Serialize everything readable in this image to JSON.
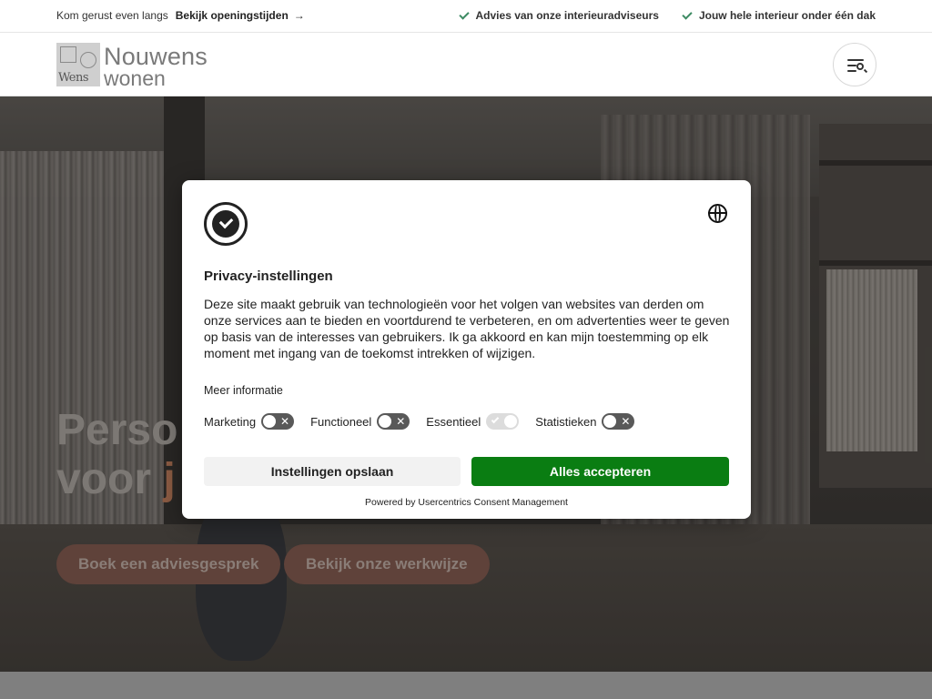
{
  "topbar": {
    "intro": "Kom gerust even langs",
    "opening_link": "Bekijk openingstijden",
    "arrow_icon": "→",
    "usps": [
      "Advies van onze interieuradviseurs",
      "Jouw hele interieur onder één dak"
    ]
  },
  "header": {
    "logo_line1": "Nouwens",
    "logo_line2": "wonen",
    "logo_mark_text": "Wens",
    "menu_icon": "menu-search-icon"
  },
  "hero": {
    "title_line1": "Perso",
    "title_line2": "voor",
    "title_accent": "j",
    "buttons": [
      "Boek een adviesgesprek",
      "Bekijk onze werkwijze"
    ]
  },
  "consent": {
    "title": "Privacy-instellingen",
    "body": "Deze site maakt gebruik van technologieën voor het volgen van websites van derden om onze services aan te bieden en voortdurend te verbeteren, en om advertenties weer te geven op basis van de interesses van gebruikers. Ik ga akkoord en kan mijn toestemming op elk moment met ingang van de toekomst intrekken of wijzigen.",
    "more_info": "Meer informatie",
    "toggles": [
      {
        "label": "Marketing",
        "state": "off"
      },
      {
        "label": "Functioneel",
        "state": "off"
      },
      {
        "label": "Essentieel",
        "state": "on-disabled"
      },
      {
        "label": "Statistieken",
        "state": "off"
      }
    ],
    "save_label": "Instellingen opslaan",
    "accept_label": "Alles accepteren",
    "powered_by": "Powered by Usercentrics Consent Management",
    "accent_color": "#0a7d12"
  }
}
